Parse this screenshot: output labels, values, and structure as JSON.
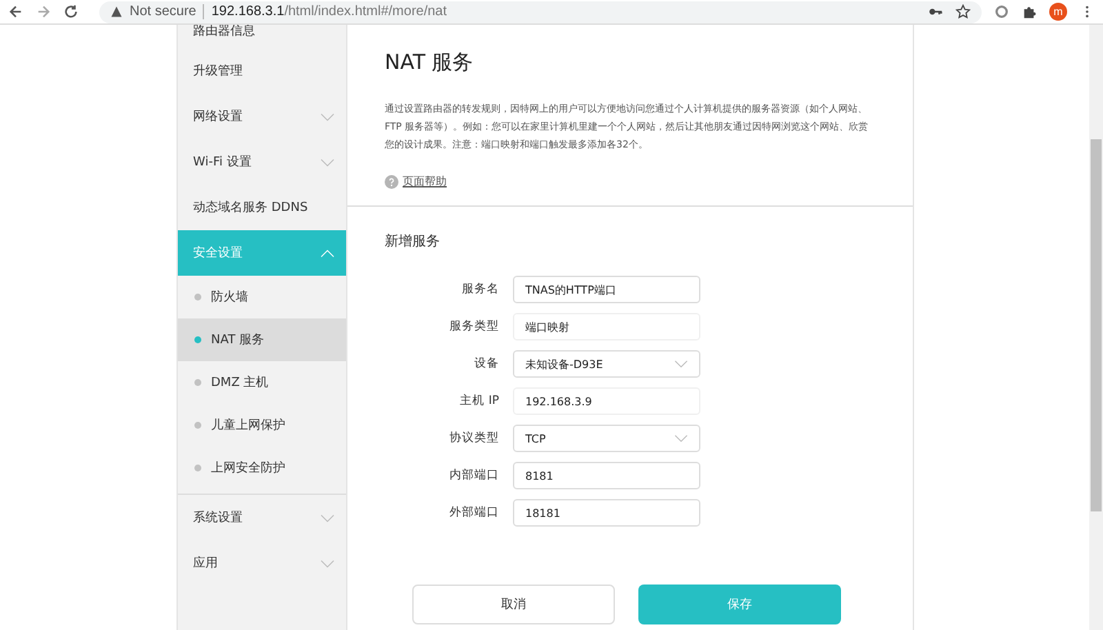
{
  "browser": {
    "security": "Not secure",
    "url_host": "192.168.3.1",
    "url_path": "/html/index.html#/more/nat",
    "profile_initial": "m"
  },
  "sidebar": {
    "items": [
      {
        "label": "路由器信息",
        "expandable": false,
        "expanded": false,
        "selected": false
      },
      {
        "label": "升级管理",
        "expandable": false,
        "expanded": false,
        "selected": false
      },
      {
        "label": "网络设置",
        "expandable": true,
        "expanded": false,
        "selected": false
      },
      {
        "label": "Wi-Fi 设置",
        "expandable": true,
        "expanded": false,
        "selected": false
      },
      {
        "label": "动态域名服务 DDNS",
        "expandable": false,
        "expanded": false,
        "selected": false
      },
      {
        "label": "安全设置",
        "expandable": true,
        "expanded": true,
        "selected": true,
        "children": [
          {
            "label": "防火墙",
            "selected": false
          },
          {
            "label": "NAT 服务",
            "selected": true
          },
          {
            "label": "DMZ 主机",
            "selected": false
          },
          {
            "label": "儿童上网保护",
            "selected": false
          },
          {
            "label": "上网安全防护",
            "selected": false
          }
        ]
      },
      {
        "label": "系统设置",
        "expandable": true,
        "expanded": false,
        "selected": false
      },
      {
        "label": "应用",
        "expandable": true,
        "expanded": false,
        "selected": false
      }
    ]
  },
  "main": {
    "title": "NAT 服务",
    "description": "通过设置路由器的转发规则，因特网上的用户可以方便地访问您通过个人计算机提供的服务器资源（如个人网站、FTP 服务器等）。例如：您可以在家里计算机里建一个个人网站，然后让其他朋友通过因特网浏览这个网站、欣赏您的设计成果。注意：端口映射和端口触发最多添加各32个。",
    "help_link": "页面帮助",
    "section_title": "新增服务",
    "fields": [
      {
        "label": "服务名",
        "kind": "input",
        "value": "TNAS的HTTP端口",
        "disabled": false
      },
      {
        "label": "服务类型",
        "kind": "input",
        "value": "端口映射",
        "disabled": true
      },
      {
        "label": "设备",
        "kind": "select",
        "value": "未知设备-D93E",
        "disabled": false
      },
      {
        "label": "主机 IP",
        "kind": "input",
        "value": "192.168.3.9",
        "disabled": true
      },
      {
        "label": "协议类型",
        "kind": "select",
        "value": "TCP",
        "disabled": false
      },
      {
        "label": "内部端口",
        "kind": "input",
        "value": "8181",
        "disabled": false
      },
      {
        "label": "外部端口",
        "kind": "input",
        "value": "18181",
        "disabled": false
      }
    ],
    "buttons": [
      {
        "label": "取消",
        "kind": "secondary"
      },
      {
        "label": "保存",
        "kind": "primary"
      }
    ]
  }
}
